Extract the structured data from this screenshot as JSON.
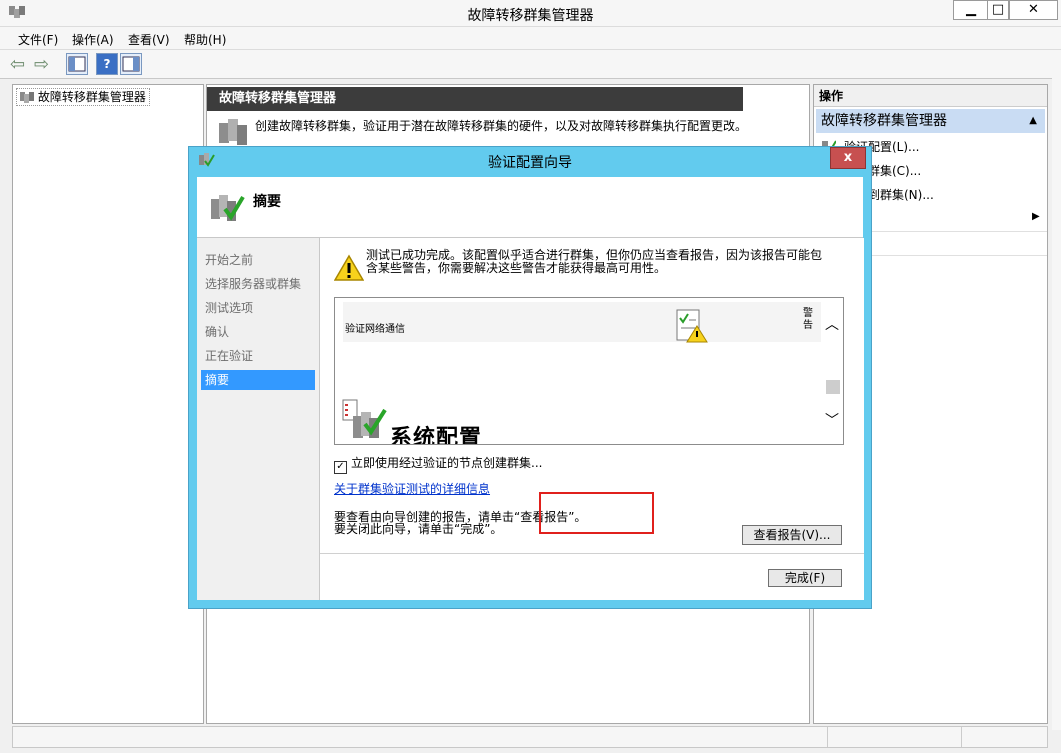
{
  "window": {
    "title": "故障转移群集管理器",
    "minimize": "▁",
    "maximize": "□",
    "close": "✕"
  },
  "menu": [
    "文件(F)",
    "操作(A)",
    "查看(V)",
    "帮助(H)"
  ],
  "tree": {
    "root": "故障转移群集管理器"
  },
  "center": {
    "header": "故障转移群集管理器",
    "description": "创建故障转移群集，验证用于潜在故障转移群集的硬件，以及对故障转移群集执行配置更改。"
  },
  "actions": {
    "header": "操作",
    "section": "故障转移群集管理器",
    "items": [
      "验证配置(L)...",
      "群集(C)...",
      "到群集(N)..."
    ]
  },
  "dialog": {
    "title": "验证配置向导",
    "close": "x",
    "heading": "摘要",
    "steps": [
      "开始之前",
      "选择服务器或群集",
      "测试选项",
      "确认",
      "正在验证",
      "摘要"
    ],
    "active_step": 5,
    "warning": "测试已成功完成。该配置似乎适合进行群集，但你仍应当查看报告，因为该报告可能包含某些警告，你需要解决这些警告才能获得最高可用性。",
    "report": {
      "row_label": "验证网络通信",
      "row_status": "警告",
      "section_title": "系统配置"
    },
    "checkbox_label": "立即使用经过验证的节点创建群集...",
    "checkbox_checked": true,
    "link": "关于群集验证测试的详细信息",
    "note_line1": "要查看由向导创建的报告，请单击“查看报告”。",
    "note_line2": "要关闭此向导，请单击“完成”。",
    "view_report_button": "查看报告(V)...",
    "finish_button": "完成(F)"
  },
  "colors": {
    "dialog_frame": "#62cbee",
    "active_step": "#3399ff",
    "highlight": "#e0201c"
  }
}
